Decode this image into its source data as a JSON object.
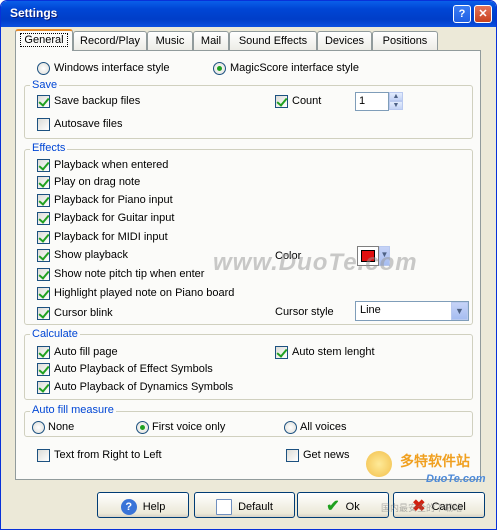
{
  "window": {
    "title": "Settings",
    "help_btn": "?",
    "close_btn": "✕"
  },
  "tabs": [
    "General",
    "Record/Play",
    "Music",
    "Mail",
    "Sound Effects",
    "Devices",
    "Positions"
  ],
  "interface_style": {
    "windows": "Windows interface style",
    "magicscore": "MagicScore interface style",
    "selected": "magicscore"
  },
  "save": {
    "title": "Save",
    "backup": "Save backup files",
    "backup_checked": true,
    "count_label": "Count",
    "count_checked": true,
    "count_value": "1",
    "autosave": "Autosave files",
    "autosave_checked": false
  },
  "effects": {
    "title": "Effects",
    "items": [
      {
        "label": "Playback when entered",
        "checked": true
      },
      {
        "label": "Play on drag note",
        "checked": true
      },
      {
        "label": "Playback for Piano input",
        "checked": true
      },
      {
        "label": "Playback for Guitar input",
        "checked": true
      },
      {
        "label": "Playback for MIDI input",
        "checked": true
      },
      {
        "label": "Show playback",
        "checked": true
      },
      {
        "label": "Show note pitch tip when enter",
        "checked": true
      },
      {
        "label": "Highlight played note on Piano board",
        "checked": true
      },
      {
        "label": "Cursor blink",
        "checked": true
      }
    ],
    "color_label": "Color",
    "color_value": "#e01010",
    "cursor_style_label": "Cursor style",
    "cursor_style_value": "Line"
  },
  "calculate": {
    "title": "Calculate",
    "auto_fill_page": "Auto fill page",
    "auto_fill_page_checked": true,
    "auto_stem": "Auto stem lenght",
    "auto_stem_checked": true,
    "auto_effect": "Auto Playback of Effect Symbols",
    "auto_effect_checked": true,
    "auto_dynamics": "Auto Playback of Dynamics Symbols",
    "auto_dynamics_checked": true
  },
  "auto_fill_measure": {
    "title": "Auto fill measure",
    "none": "None",
    "first": "First voice only",
    "all": "All voices",
    "selected": "first"
  },
  "misc": {
    "rtl": "Text from Right to Left",
    "rtl_checked": false,
    "news": "Get news",
    "news_checked": false
  },
  "buttons": {
    "help": "Help",
    "default": "Default",
    "ok": "Ok",
    "cancel": "Cancel"
  },
  "watermarks": {
    "duote": "www.DuoTe.com",
    "logo": "多特软件站",
    "logo_sub": "DuoTe.com",
    "logo_caption": "国内最安全的下载站"
  }
}
